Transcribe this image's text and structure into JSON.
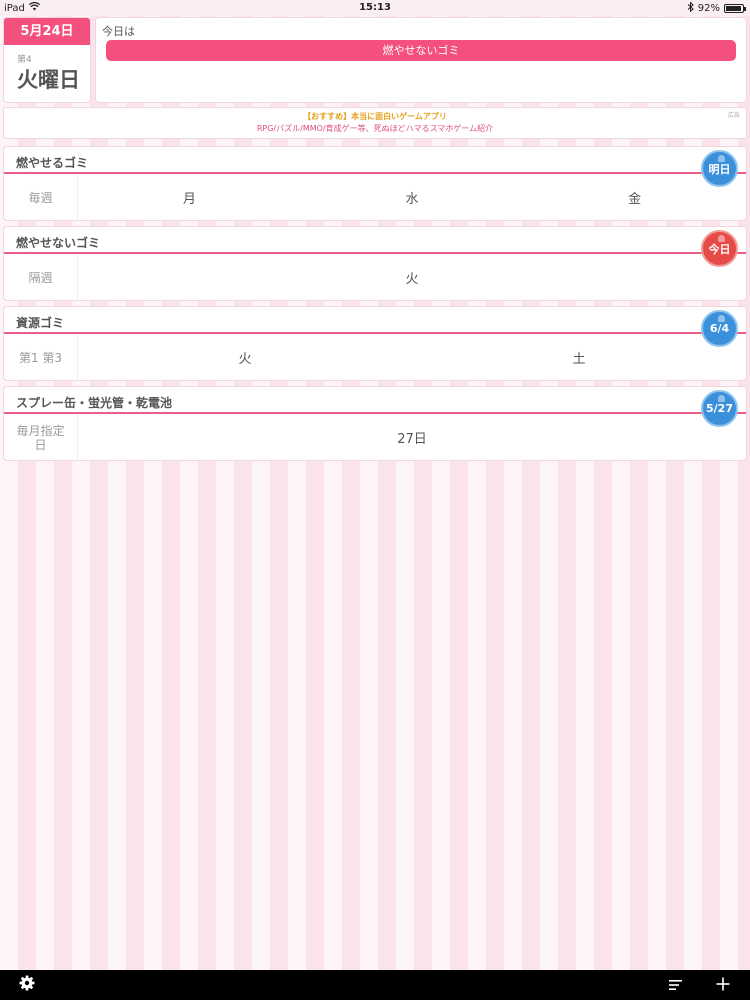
{
  "status_bar": {
    "device": "iPad",
    "time": "15:13",
    "battery": "92%",
    "battery_level": 0.92
  },
  "header": {
    "date": "5月24日",
    "week_of_month": "第4",
    "weekday": "火曜日",
    "today_label": "今日は",
    "today_garbage": "燃やせないゴミ"
  },
  "ad": {
    "line1": "【おすすめ】本当に面白いゲームアプリ",
    "line2": "RPG/パズル/MMO/育成ゲー等、死ぬほどハマるスマホゲーム紹介",
    "tag": "広告"
  },
  "categories": [
    {
      "title": "燃やせるゴミ",
      "schedule": "毎週",
      "days": [
        "月",
        "水",
        "金"
      ],
      "badge": "明日",
      "badge_color": "#3b90dc"
    },
    {
      "title": "燃やせないゴミ",
      "schedule": "隔週",
      "days": [
        "火"
      ],
      "badge": "今日",
      "badge_color": "#e64b48"
    },
    {
      "title": "資源ゴミ",
      "schedule": "第1 第3",
      "days": [
        "火",
        "土"
      ],
      "badge": "6/4",
      "badge_color": "#3b90dc"
    },
    {
      "title": "スプレー缶・蛍光管・乾電池",
      "schedule": "毎月指定日",
      "days": [
        "27日"
      ],
      "badge": "5/27",
      "badge_color": "#3b90dc"
    }
  ],
  "toolbar": {
    "settings_icon": "gear-icon",
    "list_icon": "list-icon",
    "add_icon": "plus-icon"
  },
  "colors": {
    "accent": "#f4507d",
    "divider": "#ea5e8a"
  }
}
